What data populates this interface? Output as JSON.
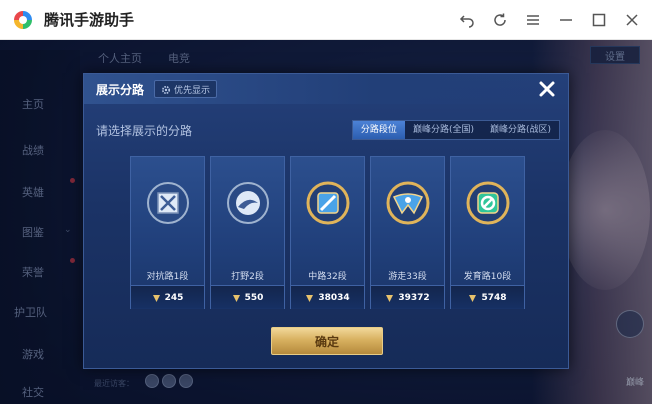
{
  "window": {
    "title": "腾讯手游助手",
    "colors": {
      "logo_blue": "#2f8cf1",
      "logo_green": "#2fbf6a",
      "logo_yellow": "#f5b62c",
      "logo_red": "#e9474b"
    }
  },
  "game_bg": {
    "tabs": [
      "个人主页",
      "电竞"
    ],
    "nav": [
      "主页",
      "战绩",
      "英雄",
      "图鉴",
      "荣誉",
      "护卫队",
      "游戏",
      "社交"
    ],
    "top_right_button": "设置",
    "bottom_hint": "最近访客：",
    "side_label": "巅峰"
  },
  "modal": {
    "title": "展示分路",
    "priority_label": "优先显示",
    "prompt": "请选择展示的分路",
    "segments": [
      {
        "label": "分路段位",
        "active": true
      },
      {
        "label": "巅峰分路(全国)",
        "active": false
      },
      {
        "label": "巅峰分路(战区)",
        "active": false
      }
    ],
    "cards": [
      {
        "label": "对抗路1段",
        "count": "245",
        "icon": "clash-lane-icon",
        "ring": "#9fb3cf",
        "core": "#dfe9f7"
      },
      {
        "label": "打野2段",
        "count": "550",
        "icon": "jungle-icon",
        "ring": "#9fb3cf",
        "core": "#dfe9f7"
      },
      {
        "label": "中路32段",
        "count": "38034",
        "icon": "mid-lane-icon",
        "ring": "#e0b45a",
        "core": "#4aa3e8"
      },
      {
        "label": "游走33段",
        "count": "39372",
        "icon": "roam-icon",
        "ring": "#e0b45a",
        "core": "#4aa3e8"
      },
      {
        "label": "发育路10段",
        "count": "5748",
        "icon": "farm-lane-icon",
        "ring": "#e0b45a",
        "core": "#2fc59a"
      }
    ],
    "confirm_label": "确定"
  }
}
